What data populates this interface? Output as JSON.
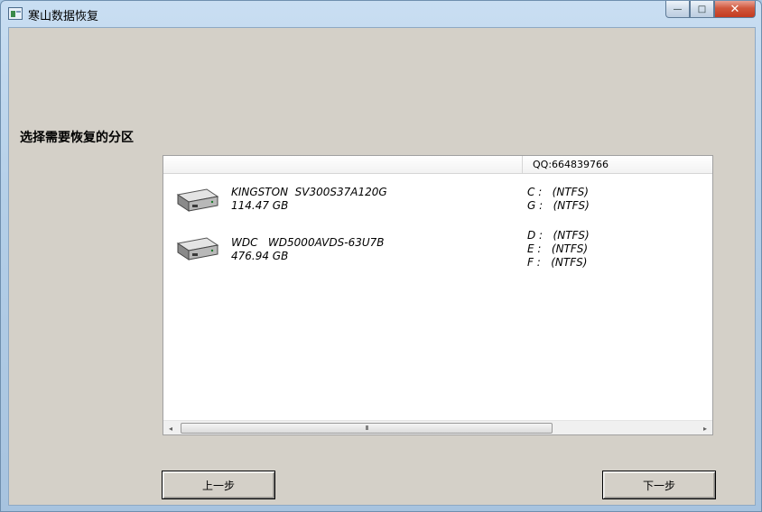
{
  "window": {
    "title": "寒山数据恢复",
    "min_glyph": "—",
    "max_glyph": "□",
    "close_glyph": "✕"
  },
  "page": {
    "heading": "选择需要恢复的分区"
  },
  "list": {
    "header_qq": "QQ:664839766",
    "disks": [
      {
        "name": "KINGSTON  SV300S37A120G",
        "size": "114.47 GB",
        "icon": "hard-drive-icon",
        "partitions": [
          "C :   (NTFS)",
          "G :   (NTFS)"
        ]
      },
      {
        "name": "WDC   WD5000AVDS-63U7B",
        "size": "476.94 GB",
        "icon": "hard-drive-icon",
        "partitions": [
          "D :   (NTFS)",
          "E :   (NTFS)",
          "F :   (NTFS)"
        ]
      }
    ],
    "scroll_left": "◂",
    "scroll_right": "▸",
    "scroll_grip": "III"
  },
  "buttons": {
    "prev": "上一步",
    "next": "下一步"
  },
  "colors": {
    "client_bg": "#d4d0c8",
    "frame": "#a9c8e4",
    "close_button": "#c43a1f"
  }
}
